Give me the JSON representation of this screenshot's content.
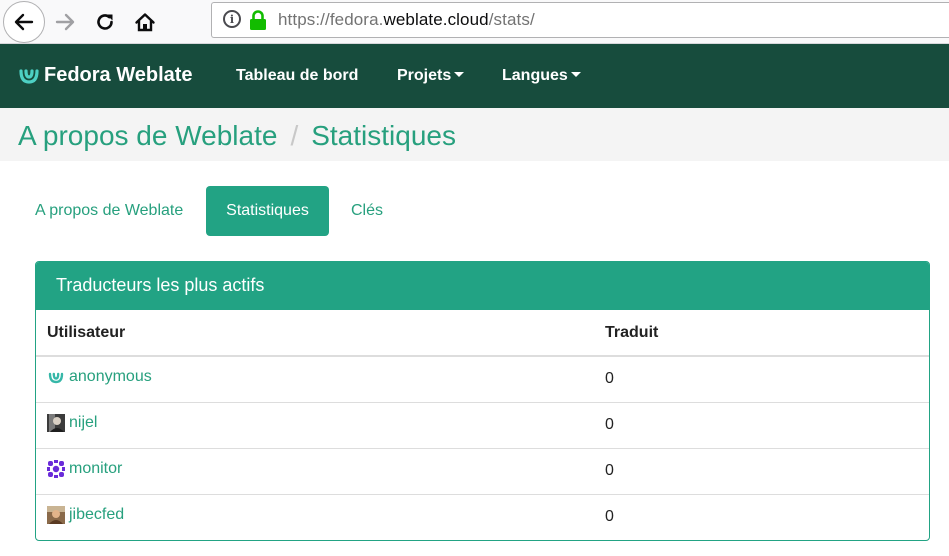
{
  "browser": {
    "url_prefix": "https://fedora.",
    "url_domain": "weblate.cloud",
    "url_suffix": "/stats/"
  },
  "navbar": {
    "brand": "Fedora Weblate",
    "items": [
      {
        "label": "Tableau de bord"
      },
      {
        "label": "Projets"
      },
      {
        "label": "Langues"
      }
    ],
    "accent_color": "#174c3d"
  },
  "breadcrumb": {
    "parent": "A propos de Weblate",
    "separator": "/",
    "current": "Statistiques"
  },
  "tabs": [
    {
      "label": "A propos de Weblate",
      "active": false
    },
    {
      "label": "Statistiques",
      "active": true
    },
    {
      "label": "Clés",
      "active": false
    }
  ],
  "panel": {
    "title": "Traducteurs les plus actifs",
    "columns": [
      "Utilisateur",
      "Traduit"
    ],
    "rows": [
      {
        "user": "anonymous",
        "avatar": "weblate-logo-icon",
        "translated": "0"
      },
      {
        "user": "nijel",
        "avatar": "photo-avatar",
        "translated": "0"
      },
      {
        "user": "monitor",
        "avatar": "identicon-avatar",
        "translated": "0"
      },
      {
        "user": "jibecfed",
        "avatar": "photo-avatar",
        "translated": "0"
      }
    ]
  },
  "colors": {
    "primary": "#22a384",
    "link": "#27a07e",
    "navbar": "#174c3d"
  }
}
